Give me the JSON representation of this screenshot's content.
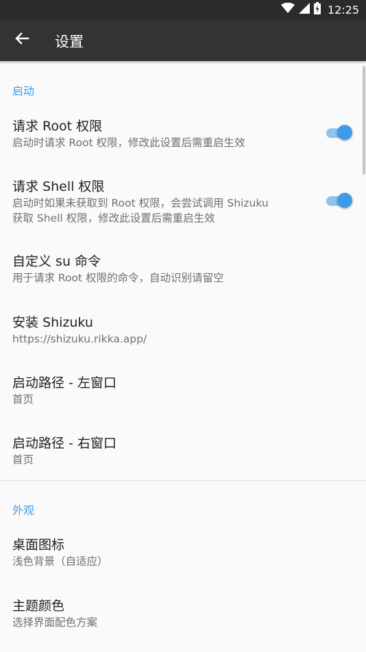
{
  "status_bar": {
    "time": "12:25",
    "icons": [
      "wifi-icon",
      "cellular-signal-icon",
      "battery-charging-icon"
    ]
  },
  "toolbar": {
    "back_icon": "arrow-left-icon",
    "title": "设置"
  },
  "sections": [
    {
      "header": "启动",
      "items": [
        {
          "title": "请求 Root 权限",
          "summary": "启动时请求 Root 权限，修改此设置后需重启生效",
          "switch": true
        },
        {
          "title": "请求 Shell 权限",
          "summary_line1": "启动时如果未获取到 Root 权限，会尝试调用 Shizuku",
          "summary_line2": "获取 Shell 权限，修改此设置后需重启生效",
          "switch": true
        },
        {
          "title": "自定义 su 命令",
          "summary": "用于请求 Root 权限的命令，自动识别请留空"
        },
        {
          "title": "安装 Shizuku",
          "summary": "https://shizuku.rikka.app/"
        },
        {
          "title": "启动路径 - 左窗口",
          "summary": "首页"
        },
        {
          "title": "启动路径 - 右窗口",
          "summary": "首页"
        }
      ]
    },
    {
      "header": "外观",
      "items": [
        {
          "title": "桌面图标",
          "summary": "浅色背景（自适应）"
        },
        {
          "title": "主题颜色",
          "summary": "选择界面配色方案"
        }
      ]
    }
  ],
  "colors": {
    "accent": "#3f9ae8",
    "toolbar": "#333333",
    "background": "#fafafa"
  }
}
